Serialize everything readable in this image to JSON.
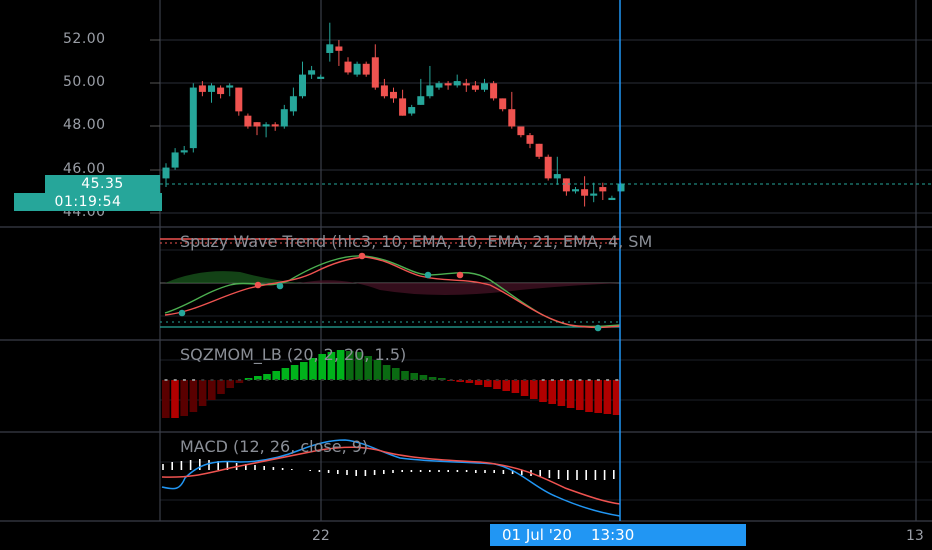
{
  "price_axis": {
    "labels": [
      "52.00",
      "50.00",
      "48.00",
      "46.00",
      "44.00"
    ],
    "current_price": "45.35",
    "countdown": "01:19:54"
  },
  "indicators": {
    "wave_trend": "Spuzy Wave Trend (hlc3, 10, EMA, 10, EMA, 21, EMA, 4, SM",
    "squeeze_momentum": "SQZMOM_LB (20, 2, 20, 1.5)",
    "macd": "MACD (12, 26, close, 9)"
  },
  "time_axis": {
    "label_22": "22",
    "label_13": "13",
    "cursor_time": "01 Jul '20    13:30"
  },
  "colors": {
    "up": "#26a69a",
    "down": "#ef5350",
    "cursor": "#2196f3",
    "grid": "#2a2e39"
  },
  "chart_data": {
    "type": "candlestick",
    "ylim": [
      43.6,
      53.0
    ],
    "candles": [
      [
        45.6,
        46.1,
        45.2,
        46.3
      ],
      [
        46.1,
        46.8,
        46.0,
        47.0
      ],
      [
        46.8,
        46.9,
        46.7,
        47.1
      ],
      [
        47.0,
        49.8,
        46.8,
        50.0
      ],
      [
        49.9,
        49.6,
        49.4,
        50.1
      ],
      [
        49.6,
        49.9,
        49.1,
        50.0
      ],
      [
        49.8,
        49.5,
        49.3,
        49.9
      ],
      [
        49.8,
        49.9,
        49.4,
        50.0
      ],
      [
        49.8,
        48.7,
        48.5,
        49.8
      ],
      [
        48.5,
        48.0,
        47.9,
        48.6
      ],
      [
        48.2,
        48.0,
        47.6,
        48.2
      ],
      [
        48.0,
        48.1,
        47.5,
        48.2
      ],
      [
        48.1,
        48.0,
        47.8,
        48.2
      ],
      [
        48.0,
        48.8,
        47.9,
        49.0
      ],
      [
        48.7,
        49.4,
        48.5,
        49.8
      ],
      [
        49.4,
        50.4,
        49.3,
        51.0
      ],
      [
        50.4,
        50.6,
        50.2,
        50.8
      ],
      [
        50.2,
        50.3,
        50.2,
        50.4
      ],
      [
        51.4,
        51.8,
        51.0,
        52.8
      ],
      [
        51.7,
        51.5,
        50.8,
        52.0
      ],
      [
        51.0,
        50.5,
        50.4,
        51.2
      ],
      [
        50.4,
        50.9,
        50.3,
        51.0
      ],
      [
        50.9,
        50.4,
        50.3,
        51.0
      ],
      [
        51.2,
        49.8,
        49.7,
        51.8
      ],
      [
        49.9,
        49.4,
        49.3,
        50.2
      ],
      [
        49.6,
        49.3,
        49.1,
        49.8
      ],
      [
        49.3,
        48.5,
        48.5,
        49.7
      ],
      [
        48.6,
        48.9,
        48.5,
        49.0
      ],
      [
        49.0,
        49.4,
        49.0,
        50.2
      ],
      [
        49.4,
        49.9,
        49.3,
        50.8
      ],
      [
        49.8,
        50.0,
        49.7,
        50.1
      ],
      [
        50.0,
        49.9,
        49.7,
        50.1
      ],
      [
        49.9,
        50.1,
        49.8,
        50.4
      ],
      [
        50.0,
        49.9,
        49.6,
        50.2
      ],
      [
        49.9,
        49.7,
        49.6,
        50.1
      ],
      [
        49.7,
        50.0,
        49.6,
        50.2
      ],
      [
        50.0,
        49.3,
        49.2,
        50.1
      ],
      [
        49.3,
        48.8,
        48.7,
        49.3
      ],
      [
        48.8,
        48.0,
        47.9,
        49.6
      ],
      [
        48.0,
        47.6,
        47.5,
        48.0
      ],
      [
        47.6,
        47.2,
        47.0,
        47.7
      ],
      [
        47.2,
        46.6,
        46.5,
        47.2
      ],
      [
        46.6,
        45.6,
        45.5,
        46.7
      ],
      [
        45.6,
        45.8,
        45.3,
        46.6
      ],
      [
        45.6,
        45.0,
        44.8,
        45.6
      ],
      [
        45.0,
        45.1,
        44.9,
        45.2
      ],
      [
        45.1,
        44.8,
        44.3,
        45.7
      ],
      [
        44.8,
        44.9,
        44.5,
        45.4
      ],
      [
        45.2,
        45.0,
        44.6,
        45.4
      ],
      [
        44.6,
        44.7,
        44.6,
        44.8
      ],
      [
        45.0,
        45.35,
        45.0,
        45.4
      ]
    ]
  }
}
